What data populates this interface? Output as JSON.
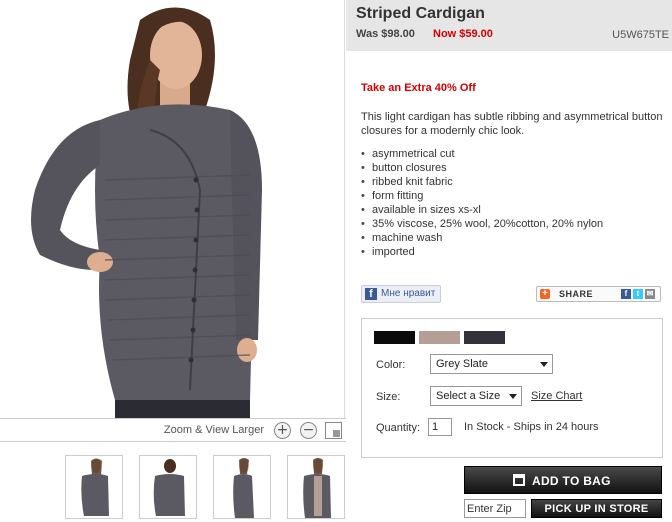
{
  "product": {
    "title": "Striped Cardigan",
    "was_price": "Was $98.00",
    "now_price": "Now $59.00",
    "sku": "U5W675TE",
    "promo": "Take an Extra 40% Off",
    "description": "This light cardigan has subtle ribbing and asymmetrical button closures for a modernly chic look.",
    "features": [
      "asymmetrical cut",
      "button closures",
      "ribbed knit fabric",
      "form fitting",
      "available in sizes xs-xl",
      "35% viscose, 25% wool, 20%cotton, 20% nylon",
      "machine wash",
      "imported"
    ]
  },
  "image_viewer": {
    "zoom_label": "Zoom & View Larger",
    "zoom_in_icon": "plus-icon",
    "zoom_out_icon": "minus-icon",
    "fullscreen_icon": "expand-icon",
    "thumbnail_count": 4
  },
  "social": {
    "facebook_like": "Мне нравит",
    "share": "SHARE"
  },
  "options": {
    "swatches": [
      {
        "name": "black",
        "color": "#0b0b0b"
      },
      {
        "name": "taupe",
        "color": "#b49e95"
      },
      {
        "name": "grey-slate",
        "color": "#33323a"
      }
    ],
    "color_label": "Color:",
    "color_value": "Grey Slate",
    "size_label": "Size:",
    "size_value": "Select a Size",
    "size_chart": "Size Chart",
    "quantity_label": "Quantity:",
    "quantity_value": "1",
    "stock": "In Stock - Ships in 24 hours"
  },
  "actions": {
    "add_to_bag": "ADD TO BAG",
    "zip_placeholder": "Enter Zip",
    "pickup": "PICK UP IN STORE"
  },
  "colors": {
    "price_red": "#d40000",
    "header_bg": "#e6e6e6",
    "sweater": "#5b5a63",
    "button_dark": "#111111"
  }
}
